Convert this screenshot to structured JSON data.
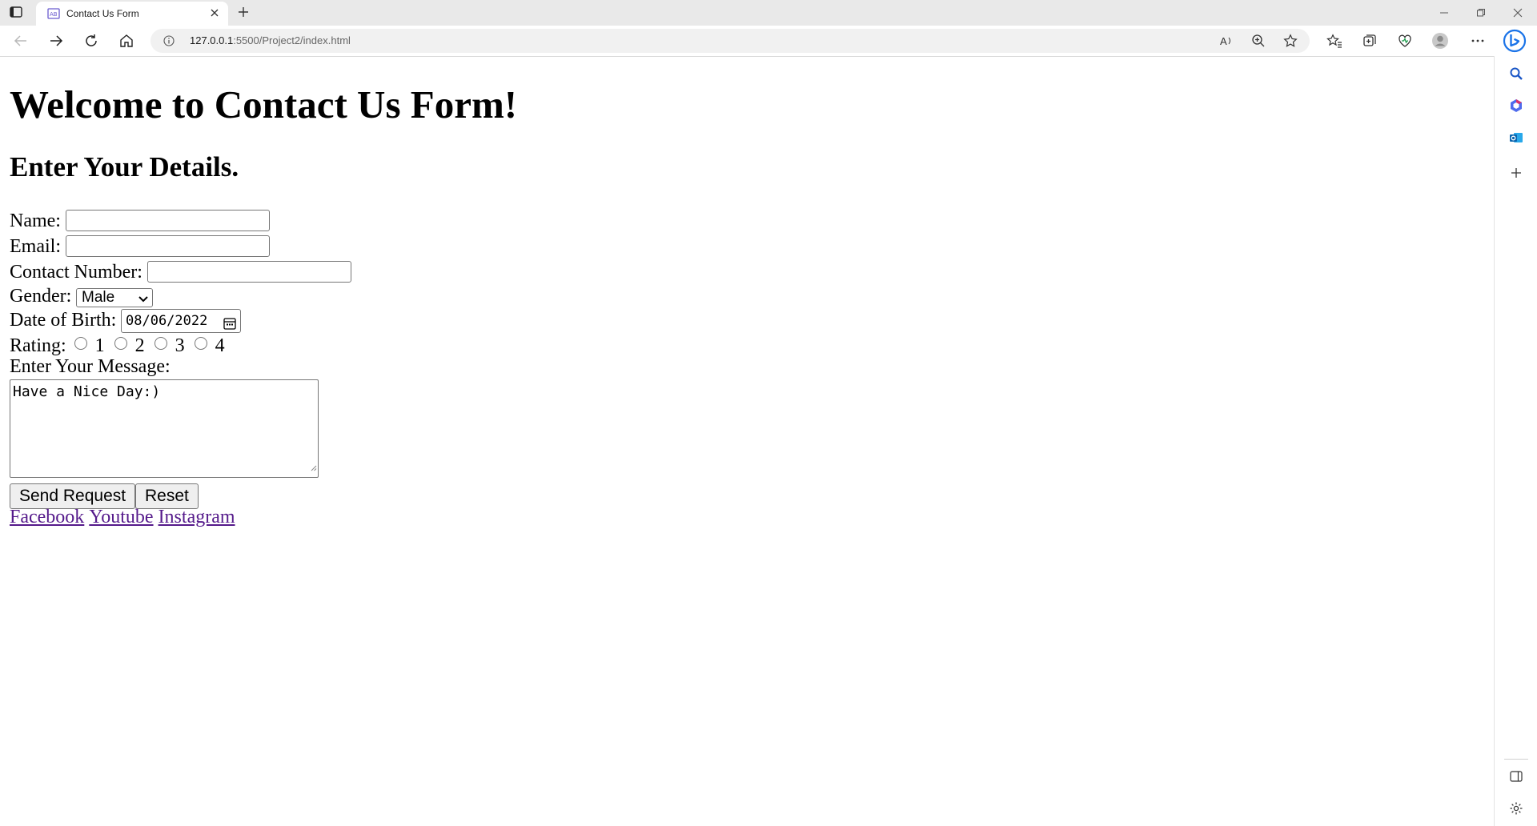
{
  "browser": {
    "tab_title": "Contact Us Form",
    "url_host": "127.0.0.1",
    "url_path": ":5500/Project2/index.html"
  },
  "page": {
    "heading": "Welcome to Contact Us Form!",
    "subheading": "Enter Your Details.",
    "form": {
      "name_label": "Name:",
      "name_value": "",
      "email_label": "Email:",
      "email_value": "",
      "contact_label": "Contact Number:",
      "contact_value": "",
      "gender_label": "Gender:",
      "gender_selected": "Male",
      "dob_label": "Date of Birth:",
      "dob_value": "08/06/2022",
      "rating_label": "Rating:",
      "rating_options": [
        "1",
        "2",
        "3",
        "4"
      ],
      "message_label": "Enter Your Message:",
      "message_value": "Have a Nice Day:)",
      "submit_label": "Send Request",
      "reset_label": "Reset"
    },
    "links": [
      "Facebook",
      "Youtube",
      "Instagram"
    ]
  },
  "colors": {
    "visited_link": "#551a8b",
    "chrome_bg": "#e9e9e9",
    "bing_accent": "#1a73e8"
  }
}
